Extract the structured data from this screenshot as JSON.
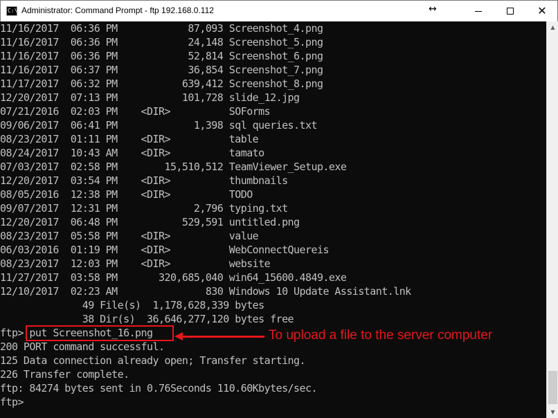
{
  "window": {
    "title": "Administrator: Command Prompt - ftp  192.168.0.112",
    "icon_text": "C:\\",
    "resize_glyph": "↔",
    "close_glyph": "✕"
  },
  "console": {
    "lines": [
      "11/16/2017  06:36 PM            87,093 Screenshot_4.png",
      "11/16/2017  06:36 PM            24,148 Screenshot_5.png",
      "11/16/2017  06:36 PM            52,814 Screenshot_6.png",
      "11/16/2017  06:37 PM            36,854 Screenshot_7.png",
      "11/17/2017  06:32 PM           639,412 Screenshot_8.png",
      "12/20/2017  07:13 PM           101,728 slide_12.jpg",
      "07/21/2016  02:03 PM    <DIR>          SOForms",
      "09/06/2017  06:41 PM             1,398 sql queries.txt",
      "08/23/2017  01:11 PM    <DIR>          table",
      "08/24/2017  10:43 AM    <DIR>          tamato",
      "07/03/2017  02:58 PM        15,510,512 TeamViewer_Setup.exe",
      "12/20/2017  03:54 PM    <DIR>          thumbnails",
      "08/05/2016  12:38 PM    <DIR>          TODO",
      "09/07/2017  12:31 PM             2,796 typing.txt",
      "12/20/2017  06:48 PM           529,591 untitled.png",
      "08/23/2017  05:58 PM    <DIR>          value",
      "06/03/2016  01:19 PM    <DIR>          WebConnectQuereis",
      "08/23/2017  12:03 PM    <DIR>          website",
      "11/27/2017  03:58 PM       320,685,040 win64_15600.4849.exe",
      "12/10/2017  02:23 AM               830 Windows 10 Update Assistant.lnk",
      "              49 File(s)  1,178,628,339 bytes",
      "              38 Dir(s)  36,646,277,120 bytes free",
      "ftp> put Screenshot_16.png",
      "200 PORT command successful.",
      "125 Data connection already open; Transfer starting.",
      "226 Transfer complete.",
      "ftp: 84274 bytes sent in 0.76Seconds 110.60Kbytes/sec.",
      "ftp>"
    ]
  },
  "annotation": {
    "text": "To upload a file to the server computer"
  },
  "colors": {
    "console_bg": "#0c0c0c",
    "console_fg": "#c0c0c0",
    "annotation_red": "#e8161a"
  }
}
